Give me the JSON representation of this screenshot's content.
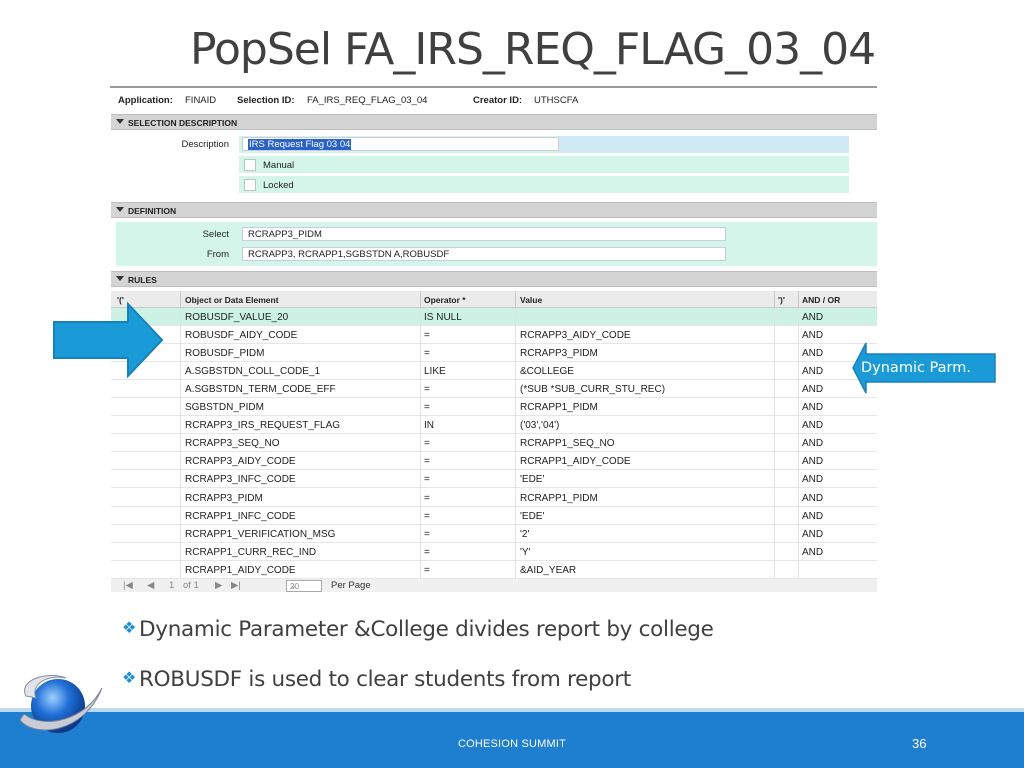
{
  "slide": {
    "title": "PopSel FA_IRS_REQ_FLAG_03_04",
    "bullets": [
      "Dynamic Parameter &College divides report by college",
      "ROBUSDF is used to clear students from report"
    ],
    "footer": "COHESION SUMMIT",
    "page_number": "36",
    "callout_text": "Dynamic Parm."
  },
  "app": {
    "application_label": "Application:",
    "application_value": "FINAID",
    "selection_id_label": "Selection ID:",
    "selection_id_value": "FA_IRS_REQ_FLAG_03_04",
    "creator_id_label": "Creator ID:",
    "creator_id_value": "UTHSCFA"
  },
  "selection_description": {
    "header": "SELECTION DESCRIPTION",
    "description_label": "Description",
    "description_value": "IRS Request Flag 03 04",
    "manual_label": "Manual",
    "locked_label": "Locked"
  },
  "definition": {
    "header": "DEFINITION",
    "select_label": "Select",
    "select_value": "RCRAPP3_PIDM",
    "from_label": "From",
    "from_value": "RCRAPP3, RCRAPP1,SGBSTDN A,ROBUSDF"
  },
  "rules": {
    "header": "RULES",
    "columns": [
      "'('",
      "Object or Data Element",
      "Operator *",
      "Value",
      "')'",
      "AND / OR"
    ],
    "rows": [
      {
        "open": "",
        "element": "ROBUSDF_VALUE_20",
        "operator": "IS NULL",
        "value": "",
        "close": "",
        "andor": "AND"
      },
      {
        "open": "",
        "element": "ROBUSDF_AIDY_CODE",
        "operator": "=",
        "value": "RCRAPP3_AIDY_CODE",
        "close": "",
        "andor": "AND"
      },
      {
        "open": "",
        "element": "ROBUSDF_PIDM",
        "operator": "=",
        "value": "RCRAPP3_PIDM",
        "close": "",
        "andor": "AND"
      },
      {
        "open": "",
        "element": "A.SGBSTDN_COLL_CODE_1",
        "operator": "LIKE",
        "value": "&COLLEGE",
        "close": "",
        "andor": "AND"
      },
      {
        "open": "",
        "element": "A.SGBSTDN_TERM_CODE_EFF",
        "operator": "=",
        "value": "(*SUB *SUB_CURR_STU_REC)",
        "close": "",
        "andor": "AND"
      },
      {
        "open": "",
        "element": "SGBSTDN_PIDM",
        "operator": "=",
        "value": "RCRAPP1_PIDM",
        "close": "",
        "andor": "AND"
      },
      {
        "open": "",
        "element": "RCRAPP3_IRS_REQUEST_FLAG",
        "operator": "IN",
        "value": "('03','04')",
        "close": "",
        "andor": "AND"
      },
      {
        "open": "",
        "element": "RCRAPP3_SEQ_NO",
        "operator": "=",
        "value": "RCRAPP1_SEQ_NO",
        "close": "",
        "andor": "AND"
      },
      {
        "open": "",
        "element": "RCRAPP3_AIDY_CODE",
        "operator": "=",
        "value": "RCRAPP1_AIDY_CODE",
        "close": "",
        "andor": "AND"
      },
      {
        "open": "",
        "element": "RCRAPP3_INFC_CODE",
        "operator": "=",
        "value": "'EDE'",
        "close": "",
        "andor": "AND"
      },
      {
        "open": "",
        "element": "RCRAPP3_PIDM",
        "operator": "=",
        "value": "RCRAPP1_PIDM",
        "close": "",
        "andor": "AND"
      },
      {
        "open": "",
        "element": "RCRAPP1_INFC_CODE",
        "operator": "=",
        "value": "'EDE'",
        "close": "",
        "andor": "AND"
      },
      {
        "open": "",
        "element": "RCRAPP1_VERIFICATION_MSG",
        "operator": "=",
        "value": "'2'",
        "close": "",
        "andor": "AND"
      },
      {
        "open": "",
        "element": "RCRAPP1_CURR_REC_IND",
        "operator": "=",
        "value": "'Y'",
        "close": "",
        "andor": "AND"
      },
      {
        "open": "",
        "element": "RCRAPP1_AIDY_CODE",
        "operator": "=",
        "value": "&AID_YEAR",
        "close": "",
        "andor": ""
      }
    ]
  },
  "pager": {
    "page_label": "1",
    "of_label": "of 1",
    "per_page_value": "20",
    "per_page_label": "Per Page"
  },
  "colors": {
    "accent": "#1e7fd0",
    "highlight_row": "#ccf2e6",
    "arrow": "#1a9bd7"
  },
  "icons": {
    "bullet": "diamond-bullet-icon",
    "arrow": "right-arrow-icon",
    "callout": "left-arrow-callout-icon",
    "logo": "globe-swoosh-logo"
  }
}
